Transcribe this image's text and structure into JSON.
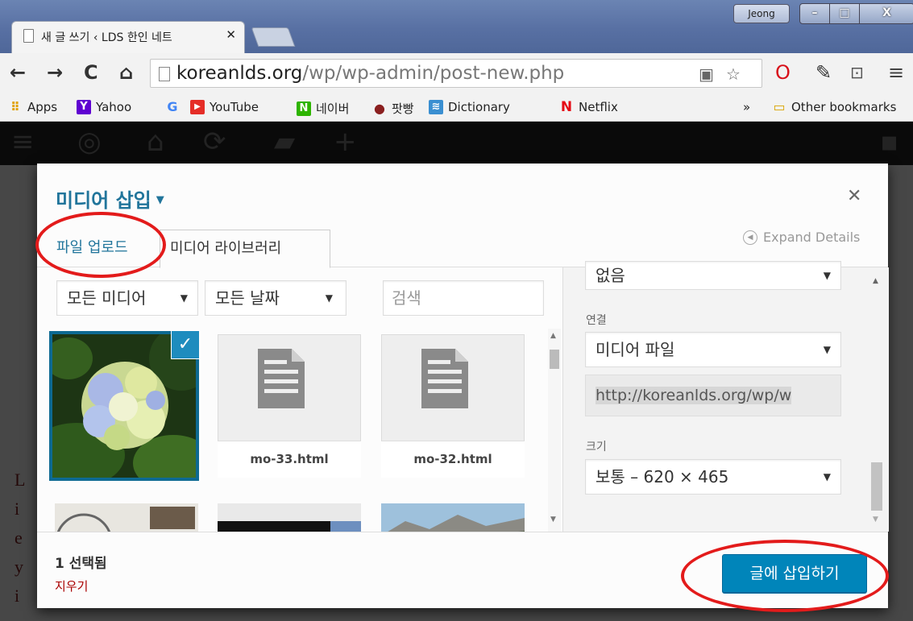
{
  "browser": {
    "tab_title": "새 글 쓰기 ‹ LDS 한인 네트",
    "tab_close": "✕",
    "profile_name": "Jeong",
    "url_host": "koreanlds.org",
    "url_path": "/wp/wp-admin/post-new.php",
    "nav": {
      "back": "←",
      "forward": "→",
      "reload": "C",
      "home": "⌂"
    },
    "bookmarks": [
      {
        "label": "Apps",
        "icon": "apps-grid-icon",
        "color": "#e0a000"
      },
      {
        "label": "Yahoo",
        "icon": "yahoo-icon",
        "color": "#5f01d1",
        "glyph": "Y"
      },
      {
        "label": "",
        "icon": "google-icon",
        "color": "#4285f4",
        "glyph": "G"
      },
      {
        "label": "YouTube",
        "icon": "youtube-icon",
        "color": "#e52d27",
        "glyph": "▶"
      },
      {
        "label": "네이버",
        "icon": "naver-icon",
        "color": "#2db400",
        "glyph": "N"
      },
      {
        "label": "팟빵",
        "icon": "podbbang-icon",
        "color": "#8a1f1f",
        "glyph": "●"
      },
      {
        "label": "Dictionary",
        "icon": "dictionary-icon",
        "color": "#3a8fd1",
        "glyph": "≋"
      },
      {
        "label": "Netflix",
        "icon": "netflix-icon",
        "color": "#e50914",
        "glyph": "N"
      }
    ],
    "bookmarks_overflow": "»",
    "other_bookmarks": "Other bookmarks"
  },
  "modal": {
    "title": "미디어 삽입",
    "title_caret": "▼",
    "close": "✕",
    "tabs": {
      "upload": "파일 업로드",
      "library": "미디어 라이브러리"
    },
    "expand_details": "Expand Details",
    "filters": {
      "type": "모든 미디어",
      "date": "모든 날짜",
      "search_placeholder": "검색",
      "arrow": "▼"
    },
    "attachments": [
      {
        "name": "",
        "kind": "image",
        "selected": true
      },
      {
        "name": "mo-33.html",
        "kind": "document",
        "selected": false
      },
      {
        "name": "mo-32.html",
        "kind": "document",
        "selected": false
      }
    ],
    "sidebar": {
      "align_value": "없음",
      "link_label": "연결",
      "link_value": "미디어 파일",
      "link_url": "http://koreanlds.org/wp/w",
      "size_label": "크기",
      "size_value": "보통 – 620 × 465"
    },
    "selection": {
      "count": "1 선택됨",
      "clear": "지우기"
    },
    "insert_button": "글에 삽입하기"
  },
  "colors": {
    "accent": "#0085ba",
    "title_blue": "#21759b",
    "annotation": "#e31b1b",
    "selected_border": "#0e6a92"
  }
}
